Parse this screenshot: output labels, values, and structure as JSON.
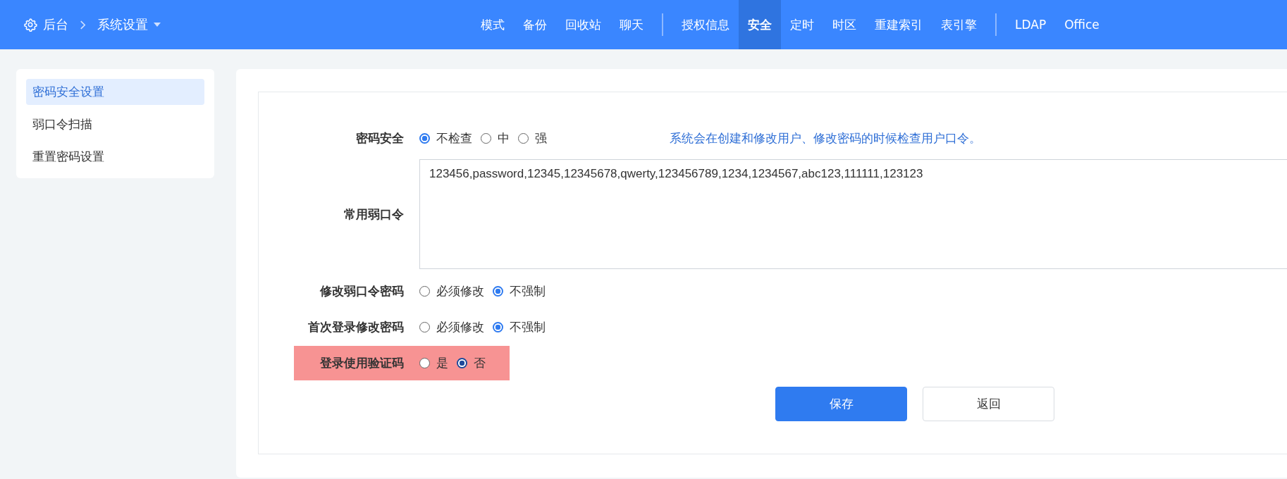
{
  "breadcrumb": {
    "home": "后台",
    "current": "系统设置"
  },
  "nav": [
    {
      "kind": "item",
      "label": "模式",
      "selected": false
    },
    {
      "kind": "item",
      "label": "备份",
      "selected": false
    },
    {
      "kind": "item",
      "label": "回收站",
      "selected": false
    },
    {
      "kind": "item",
      "label": "聊天",
      "selected": false
    },
    {
      "kind": "separator"
    },
    {
      "kind": "item",
      "label": "授权信息",
      "selected": false
    },
    {
      "kind": "item",
      "label": "安全",
      "selected": true
    },
    {
      "kind": "item",
      "label": "定时",
      "selected": false
    },
    {
      "kind": "item",
      "label": "时区",
      "selected": false
    },
    {
      "kind": "item",
      "label": "重建索引",
      "selected": false
    },
    {
      "kind": "item",
      "label": "表引擎",
      "selected": false
    },
    {
      "kind": "separator"
    },
    {
      "kind": "item",
      "label": "LDAP",
      "selected": false
    },
    {
      "kind": "item",
      "label": "Office",
      "selected": false
    }
  ],
  "sidebar": {
    "items": [
      {
        "label": "密码安全设置",
        "selected": true
      },
      {
        "label": "弱口令扫描",
        "selected": false
      },
      {
        "label": "重置密码设置",
        "selected": false
      }
    ]
  },
  "form": {
    "rows": [
      {
        "kind": "radio",
        "label": "密码安全",
        "options": [
          {
            "label": "不检查",
            "selected": true
          },
          {
            "label": "中",
            "selected": false
          },
          {
            "label": "强",
            "selected": false
          }
        ],
        "hint": "系统会在创建和修改用户、修改密码的时候检查用户口令。"
      },
      {
        "kind": "textarea",
        "label": "常用弱口令",
        "value": "123456,password,12345,12345678,qwerty,123456789,1234,1234567,abc123,111111,123123"
      },
      {
        "kind": "radio",
        "label": "修改弱口令密码",
        "options": [
          {
            "label": "必须修改",
            "selected": false
          },
          {
            "label": "不强制",
            "selected": true
          }
        ]
      },
      {
        "kind": "radio",
        "label": "首次登录修改密码",
        "options": [
          {
            "label": "必须修改",
            "selected": false
          },
          {
            "label": "不强制",
            "selected": true
          }
        ]
      },
      {
        "kind": "radio",
        "label": "登录使用验证码",
        "highlighted": true,
        "options": [
          {
            "label": "是",
            "selected": false
          },
          {
            "label": "否",
            "selected": true
          }
        ]
      }
    ],
    "buttons": [
      {
        "kind": "primary",
        "label": "保存"
      },
      {
        "kind": "default",
        "label": "返回"
      }
    ]
  }
}
